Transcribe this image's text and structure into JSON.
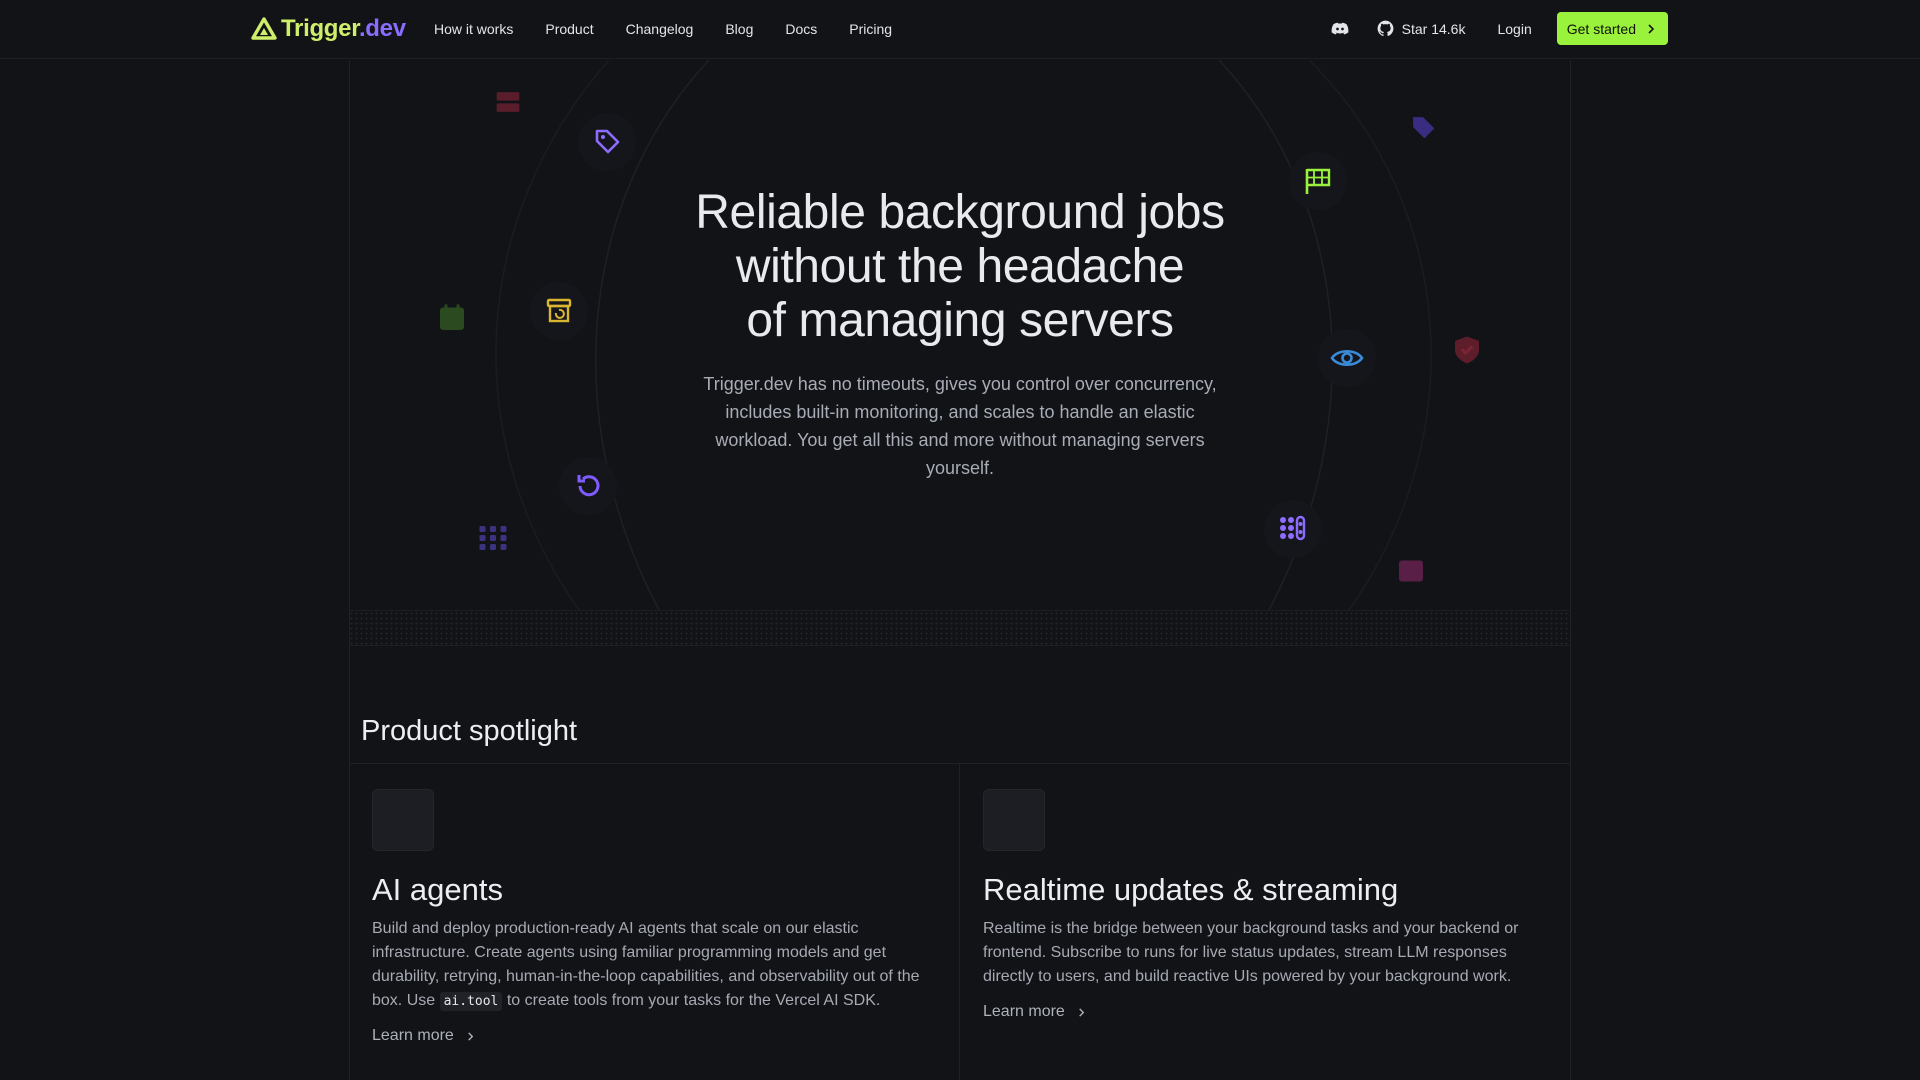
{
  "brand": {
    "name_part1": "Trigger",
    "name_part2": ".dev",
    "accent": "#9bf23d",
    "purple": "#8b6cff"
  },
  "nav": {
    "links": [
      "How it works",
      "Product",
      "Changelog",
      "Blog",
      "Docs",
      "Pricing"
    ],
    "discord_icon": "discord-icon",
    "github_star": "Star 14.6k",
    "login": "Login",
    "cta": "Get started"
  },
  "hero": {
    "title_line1": "Reliable background jobs",
    "title_line2": "without the headache",
    "title_line3": "of managing servers",
    "subtitle": "Trigger.dev has no timeouts, gives you control over concurrency, includes built-in monitoring, and scales to handle an elastic workload. You get all this and more without managing servers yourself.",
    "icons": [
      "tag-icon",
      "archive-restore-icon",
      "retry-icon",
      "flag-icon",
      "eye-icon",
      "grid-dots-icon",
      "calendar-icon",
      "server-icon",
      "shield-icon"
    ]
  },
  "spotlight": {
    "title": "Product spotlight",
    "cards": [
      {
        "title": "AI agents",
        "desc_before": "Build and deploy production-ready AI agents that scale on our elastic infrastructure. Create agents using familiar programming models and get durability, retrying, human-in-the-loop capabilities, and observability out of the box. Use ",
        "code": "ai.tool",
        "desc_after": " to create tools from your tasks for the Vercel AI SDK.",
        "link": "Learn more"
      },
      {
        "title": "Realtime updates & streaming",
        "desc": "Realtime is the bridge between your background tasks and your backend or frontend. Subscribe to runs for live status updates, stream LLM responses directly to users, and build reactive UIs powered by your background work.",
        "link": "Learn more"
      }
    ]
  }
}
